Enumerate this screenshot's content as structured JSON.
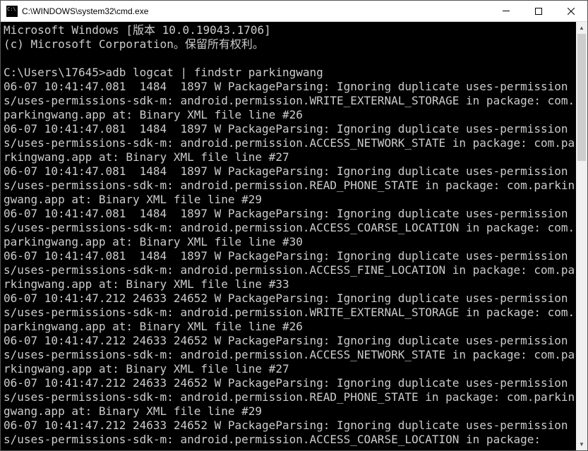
{
  "window": {
    "title": "C:\\WINDOWS\\system32\\cmd.exe"
  },
  "terminal": {
    "header_line1": "Microsoft Windows [版本 10.0.19043.1706]",
    "header_line2": "(c) Microsoft Corporation。保留所有权利。",
    "prompt": "C:\\Users\\17645>",
    "command": "adb logcat | findstr parkingwang",
    "log_entries": [
      {
        "ts": "06-07 10:41:47.081",
        "pid": "1484",
        "tid": "1897",
        "level": "W",
        "tag": "PackageParsing",
        "msg": "Ignoring duplicate uses-permissions/uses-permissions-sdk-m: android.permission.WRITE_EXTERNAL_STORAGE in package: com.parkingwang.app at: Binary XML file line #26"
      },
      {
        "ts": "06-07 10:41:47.081",
        "pid": "1484",
        "tid": "1897",
        "level": "W",
        "tag": "PackageParsing",
        "msg": "Ignoring duplicate uses-permissions/uses-permissions-sdk-m: android.permission.ACCESS_NETWORK_STATE in package: com.parkingwang.app at: Binary XML file line #27"
      },
      {
        "ts": "06-07 10:41:47.081",
        "pid": "1484",
        "tid": "1897",
        "level": "W",
        "tag": "PackageParsing",
        "msg": "Ignoring duplicate uses-permissions/uses-permissions-sdk-m: android.permission.READ_PHONE_STATE in package: com.parkingwang.app at: Binary XML file line #29"
      },
      {
        "ts": "06-07 10:41:47.081",
        "pid": "1484",
        "tid": "1897",
        "level": "W",
        "tag": "PackageParsing",
        "msg": "Ignoring duplicate uses-permissions/uses-permissions-sdk-m: android.permission.ACCESS_COARSE_LOCATION in package: com.parkingwang.app at: Binary XML file line #30"
      },
      {
        "ts": "06-07 10:41:47.081",
        "pid": "1484",
        "tid": "1897",
        "level": "W",
        "tag": "PackageParsing",
        "msg": "Ignoring duplicate uses-permissions/uses-permissions-sdk-m: android.permission.ACCESS_FINE_LOCATION in package: com.parkingwang.app at: Binary XML file line #33"
      },
      {
        "ts": "06-07 10:41:47.212",
        "pid": "24633",
        "tid": "24652",
        "level": "W",
        "tag": "PackageParsing",
        "msg": "Ignoring duplicate uses-permissions/uses-permissions-sdk-m: android.permission.WRITE_EXTERNAL_STORAGE in package: com.parkingwang.app at: Binary XML file line #26"
      },
      {
        "ts": "06-07 10:41:47.212",
        "pid": "24633",
        "tid": "24652",
        "level": "W",
        "tag": "PackageParsing",
        "msg": "Ignoring duplicate uses-permissions/uses-permissions-sdk-m: android.permission.ACCESS_NETWORK_STATE in package: com.parkingwang.app at: Binary XML file line #27"
      },
      {
        "ts": "06-07 10:41:47.212",
        "pid": "24633",
        "tid": "24652",
        "level": "W",
        "tag": "PackageParsing",
        "msg": "Ignoring duplicate uses-permissions/uses-permissions-sdk-m: android.permission.READ_PHONE_STATE in package: com.parkingwang.app at: Binary XML file line #29"
      },
      {
        "ts": "06-07 10:41:47.212",
        "pid": "24633",
        "tid": "24652",
        "level": "W",
        "tag": "PackageParsing",
        "msg": "Ignoring duplicate uses-permissions/uses-permissions-sdk-m: android.permission.ACCESS_COARSE_LOCATION in package:"
      }
    ]
  }
}
